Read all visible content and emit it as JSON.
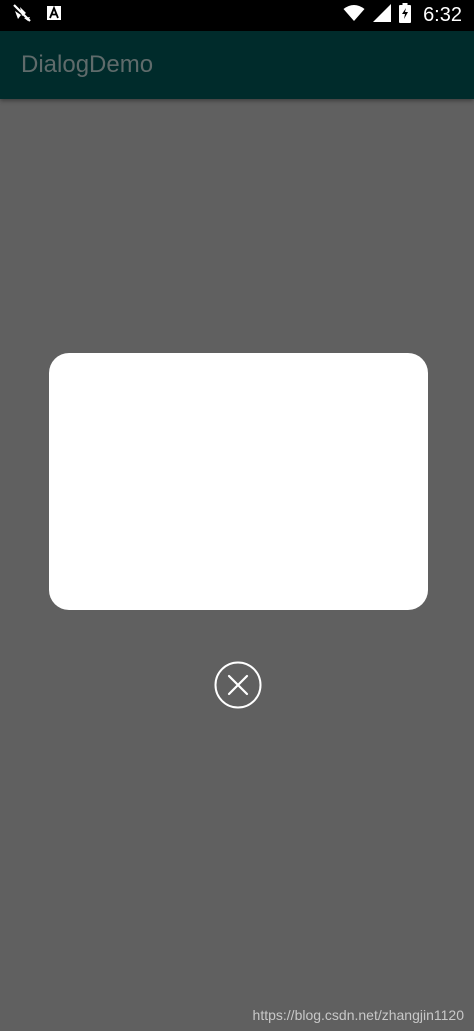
{
  "status_bar": {
    "time": "6:32",
    "icons": [
      "notification-app-icon",
      "font-app-icon",
      "wifi-icon",
      "signal-icon",
      "battery-charging-icon"
    ]
  },
  "toolbar": {
    "title": "DialogDemo"
  },
  "dialog": {
    "close_icon": "close-circle-icon"
  },
  "watermark": {
    "text": "https://blog.csdn.net/zhangjin1120"
  },
  "colors": {
    "status_bar": "#000000",
    "toolbar": "#002b2b",
    "toolbar_title": "#5f6b6b",
    "scrim": "#606060",
    "dialog": "#ffffff",
    "close_icon": "#ffffff"
  }
}
